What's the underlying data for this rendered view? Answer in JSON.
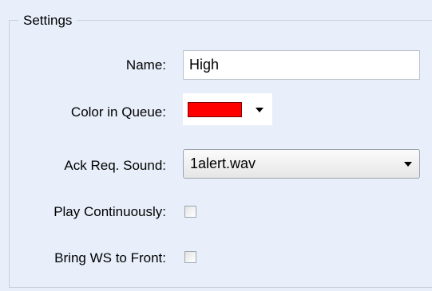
{
  "groupbox": {
    "title": "Settings"
  },
  "fields": {
    "name": {
      "label": "Name:",
      "value": "High"
    },
    "color_in_queue": {
      "label": "Color in Queue:",
      "selected_color": "#ff0000"
    },
    "ack_req_sound": {
      "label": "Ack Req. Sound:",
      "selected": "1alert.wav"
    },
    "play_continuously": {
      "label": "Play Continuously:",
      "checked": false
    },
    "bring_ws_to_front": {
      "label": "Bring WS to Front:",
      "checked": false
    }
  },
  "icons": {
    "dropdown_arrow": "chevron-down-icon"
  }
}
